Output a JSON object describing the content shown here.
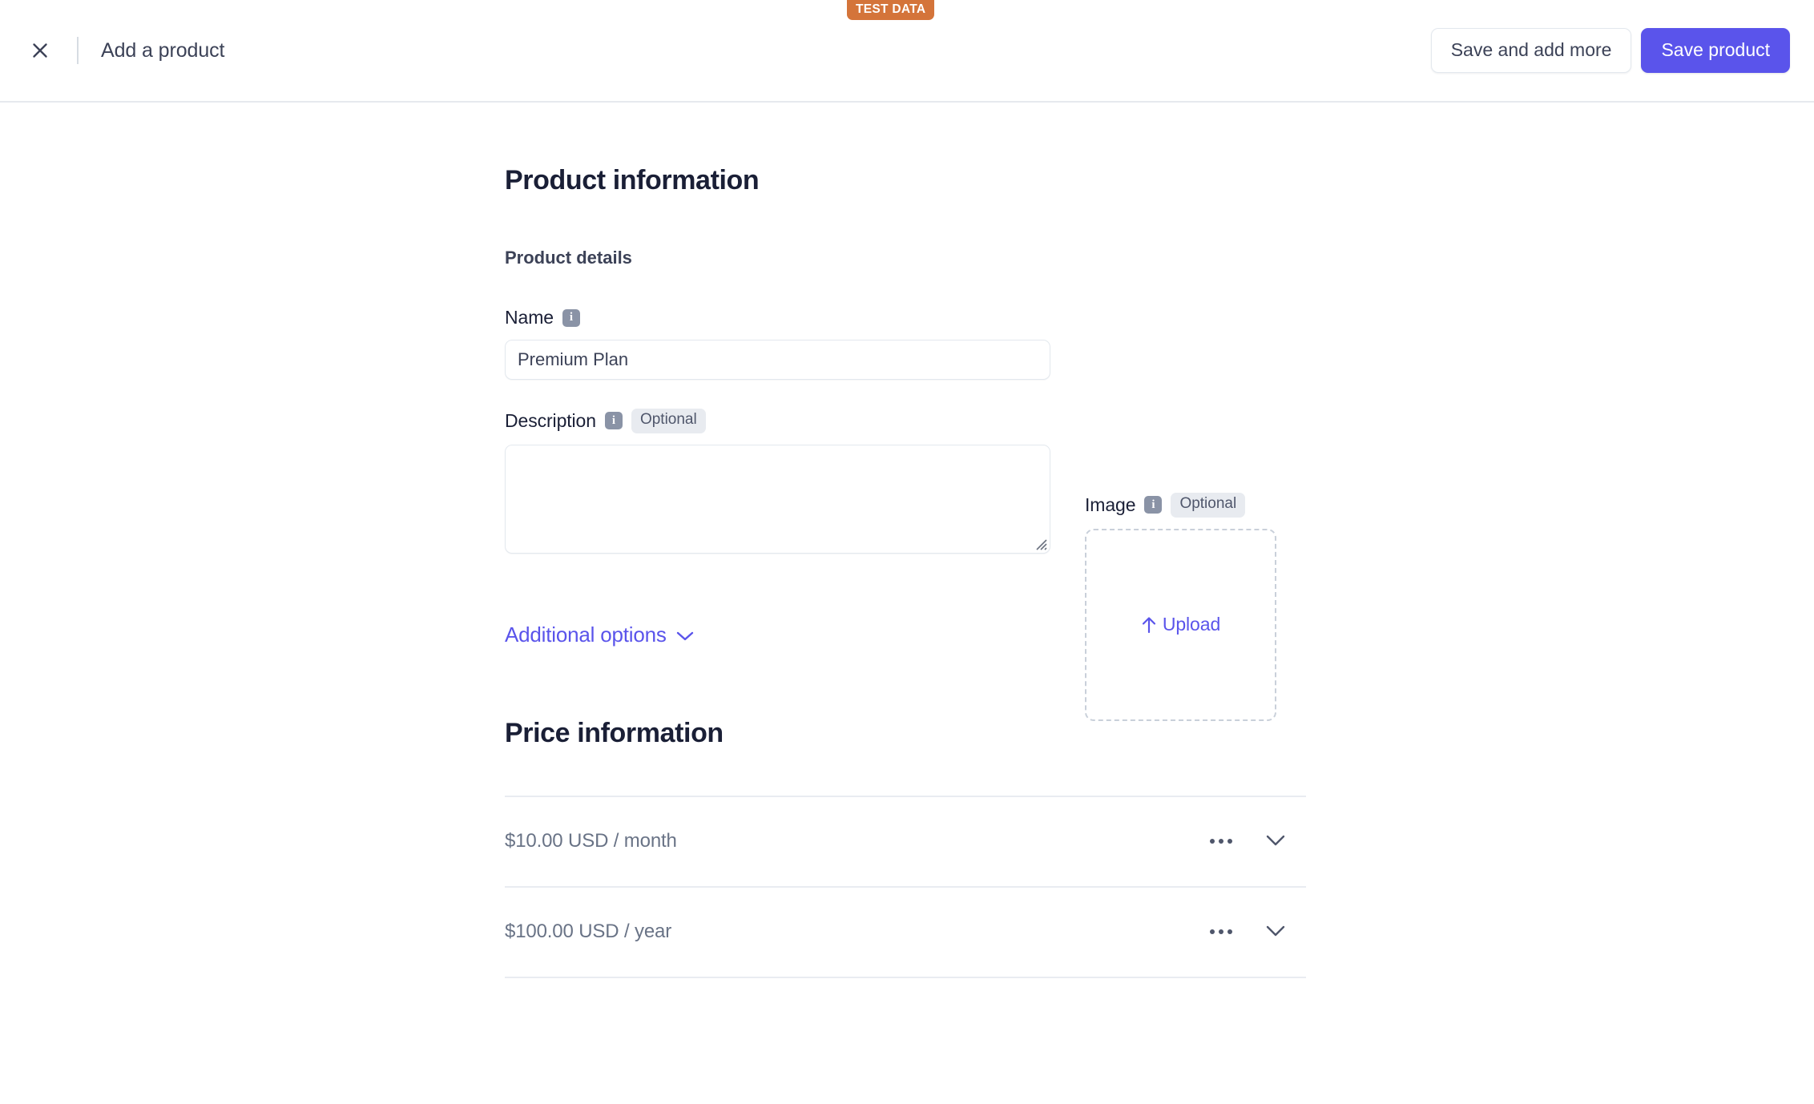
{
  "badge": {
    "label": "TEST DATA"
  },
  "header": {
    "close_icon": "close-icon",
    "title": "Add a product",
    "save_and_add_more_label": "Save and add more",
    "save_product_label": "Save product"
  },
  "product_information": {
    "section_title": "Product information",
    "subsection_title": "Product details",
    "name": {
      "label": "Name",
      "info_glyph": "i",
      "value": "Premium Plan",
      "placeholder": ""
    },
    "description": {
      "label": "Description",
      "info_glyph": "i",
      "optional_label": "Optional",
      "value": "",
      "placeholder": ""
    },
    "image": {
      "label": "Image",
      "info_glyph": "i",
      "optional_label": "Optional",
      "upload_label": "Upload"
    },
    "additional_options_label": "Additional options"
  },
  "price_information": {
    "section_title": "Price information",
    "rows": [
      {
        "label": "$10.00 USD / month"
      },
      {
        "label": "$100.00 USD / year"
      }
    ]
  },
  "colors": {
    "brand_purple": "#5a54eb",
    "test_data_orange": "#d4743a",
    "heading": "#1a1f36",
    "muted_text": "#697386",
    "border": "#e3e8ee"
  }
}
